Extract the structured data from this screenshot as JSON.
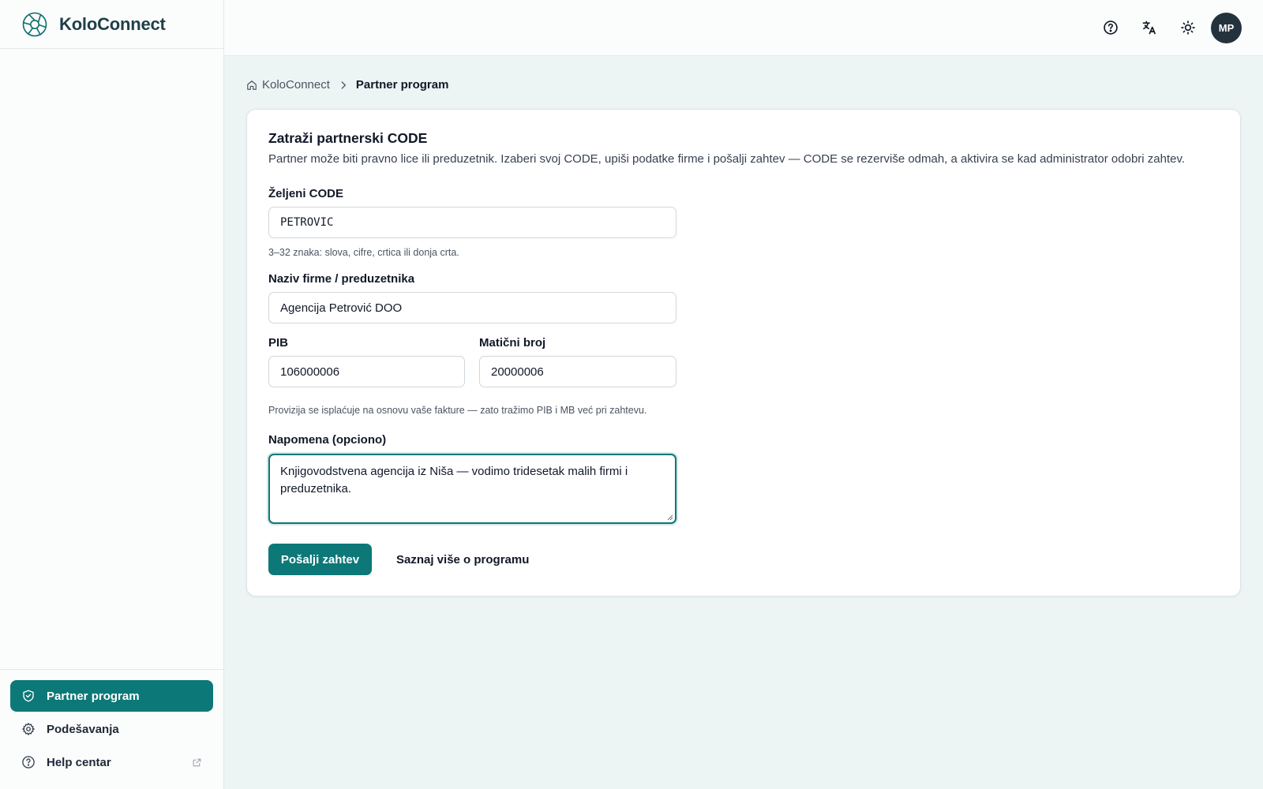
{
  "app": {
    "name": "KoloConnect"
  },
  "colors": {
    "accent": "#0d7878",
    "avatar_bg": "#24323d",
    "page_bg": "#edf4f4"
  },
  "topbar": {
    "icons": [
      "help-icon",
      "translate-icon",
      "theme-sun-icon"
    ],
    "avatar_initials": "MP"
  },
  "breadcrumb": {
    "home": "KoloConnect",
    "current": "Partner program"
  },
  "sidebar": {
    "items": [
      {
        "label": "Partner program",
        "icon": "handshake-icon",
        "active": true
      },
      {
        "label": "Podešavanja",
        "icon": "gear-icon",
        "active": false
      },
      {
        "label": "Help centar",
        "icon": "help-icon",
        "external": true,
        "active": false
      }
    ]
  },
  "form": {
    "title": "Zatraži partnerski CODE",
    "description": "Partner može biti pravno lice ili preduzetnik. Izaberi svoj CODE, upiši podatke firme i pošalji zahtev — CODE se rezerviše odmah, a aktivira se kad administrator odobri zahtev.",
    "code": {
      "label": "Željeni CODE",
      "value": "PETROVIC",
      "hint": "3–32 znaka: slova, cifre, crtica ili donja crta."
    },
    "company": {
      "label": "Naziv firme / preduzetnika",
      "value": "Agencija Petrović DOO"
    },
    "pib": {
      "label": "PIB",
      "value": "106000006"
    },
    "mb": {
      "label": "Matični broj",
      "value": "20000006"
    },
    "tax_hint": "Provizija se isplaćuje na osnovu vaše fakture — zato tražimo PIB i MB već pri zahtevu.",
    "note": {
      "label": "Napomena (opciono)",
      "value": "Knjigovodstvena agencija iz Niša — vodimo tridesetak malih firmi i preduzetnika."
    },
    "submit_label": "Pošalji zahtev",
    "learn_more_label": "Saznaj više o programu"
  }
}
